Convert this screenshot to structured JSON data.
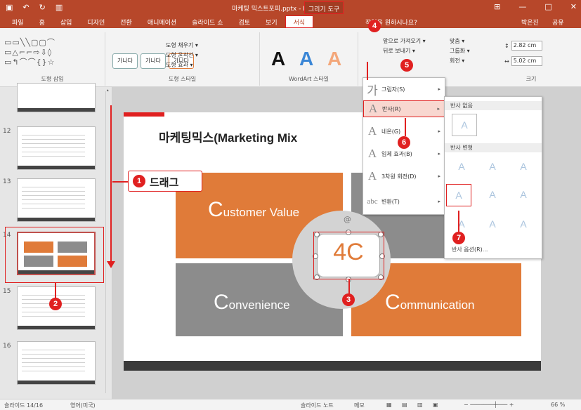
{
  "titlebar": {
    "qat_save": "▣",
    "qat_undo": "↶",
    "qat_redo": "↻",
    "qat_present": "▥",
    "doc_title": "마케팅 믹스트포피.pptx - PowerPoint",
    "context_tab": "그리기 도구",
    "win_restore": "⊞",
    "win_min": "—",
    "win_max": "□",
    "win_close": "✕"
  },
  "tabs": {
    "items": [
      "파일",
      "홈",
      "삽입",
      "디자인",
      "전환",
      "애니메이션",
      "슬라이드 쇼",
      "검토",
      "보기"
    ],
    "active": "서식",
    "tell_me": "작업을 원하시나요?",
    "user": "박은진",
    "share": "공유"
  },
  "ribbon": {
    "insert_shapes_label": "도형 삽입",
    "shape_styles_label": "도형 스타일",
    "style_sample": "가나다",
    "fill": "도형 채우기 ▾",
    "outline": "도형 윤곽선 ▾",
    "effects": "도형 효과 ▾",
    "wordart_label": "WordArt 스타일",
    "wordart_letter": "A",
    "bring_forward": "앞으로 가져오기 ▾",
    "send_backward": "뒤로 보내기 ▾",
    "align": "맞춤 ▾",
    "group": "그룹화 ▾",
    "rotate": "회전 ▾",
    "size_label": "크기",
    "height": "2.82 cm",
    "width": "5.02 cm"
  },
  "text_effects_menu": {
    "items": [
      {
        "icon": "가",
        "label": "그림자(S)"
      },
      {
        "icon": "A",
        "label": "반사(R)"
      },
      {
        "icon": "A",
        "label": "네온(G)"
      },
      {
        "icon": "A",
        "label": "입체 효과(B)"
      },
      {
        "icon": "A",
        "label": "3차원 회전(D)"
      },
      {
        "icon": "abc",
        "label": "변환(T)"
      }
    ],
    "selected_index": 1
  },
  "reflection_submenu": {
    "no_reflection_header": "반사 없음",
    "variations_header": "반사 변형",
    "cell_glyph": "A",
    "options": "반사 옵션(R)..."
  },
  "thumbnails": {
    "numbers": [
      "12",
      "13",
      "14",
      "15",
      "16"
    ],
    "selected": "14"
  },
  "slide": {
    "title": "마케팅믹스(Marketing Mix",
    "quadrants": [
      {
        "first": "C",
        "rest": "ustomer Value",
        "color": "#e07b39"
      },
      {
        "first": "C",
        "rest": "onvenience",
        "color": "#8c8c8c"
      },
      {
        "first": "C",
        "rest": "ommunication",
        "color": "#e07b39"
      }
    ],
    "center": "4C",
    "rotate_handle": "@"
  },
  "callouts": {
    "drag": "드래그",
    "steps": [
      "1",
      "2",
      "3",
      "4",
      "5",
      "6",
      "7"
    ]
  },
  "statusbar": {
    "slide_pos": "슬라이드 14/16",
    "language": "영어(미국)",
    "notes": "슬라이드 노트",
    "comments": "메모",
    "zoom": "66 %"
  },
  "colors": {
    "brand": "#b7472a",
    "orange": "#e07b39",
    "gray": "#8c8c8c",
    "callout_red": "#e02020"
  }
}
